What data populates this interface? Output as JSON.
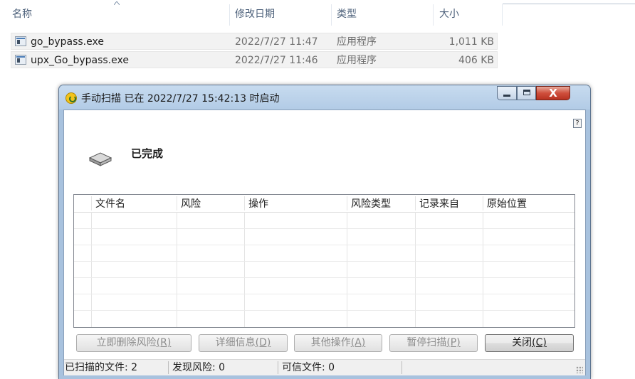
{
  "explorer": {
    "columns": {
      "name": "名称",
      "modified": "修改日期",
      "type": "类型",
      "size": "大小"
    },
    "files": [
      {
        "name": "go_bypass.exe",
        "modified": "2022/7/27 11:47",
        "type": "应用程序",
        "size": "1,011 KB",
        "icon": "exe-file-icon"
      },
      {
        "name": "upx_Go_bypass.exe",
        "modified": "2022/7/27 11:46",
        "type": "应用程序",
        "size": "406 KB",
        "icon": "exe-file-icon"
      }
    ]
  },
  "dialog": {
    "title": "手动扫描 已在 2022/7/27 15:42:13 时启动",
    "help": "?",
    "close_glyph": "X",
    "status": "已完成",
    "table_columns": [
      "文件名",
      "风险",
      "操作",
      "风险类型",
      "记录来自",
      "原始位置"
    ],
    "buttons": {
      "delete": {
        "label": "立即删除风险",
        "hotkey": "(R)"
      },
      "details": {
        "label": "详细信息",
        "hotkey": "(D)"
      },
      "other": {
        "label": "其他操作",
        "hotkey": "(A)"
      },
      "pause": {
        "label": "暂停扫描",
        "hotkey": "(P)"
      },
      "close": {
        "label": "关闭",
        "hotkey": "(C)"
      }
    },
    "statusbar": {
      "scanned": "已扫描的文件: 2",
      "risks": "发现风险: 0",
      "trusted": "可信文件: 0"
    },
    "colors": {
      "title_bar": "#b2cbe6",
      "close_button": "#cf4f3c",
      "title_icon": "#f2c31b"
    }
  }
}
